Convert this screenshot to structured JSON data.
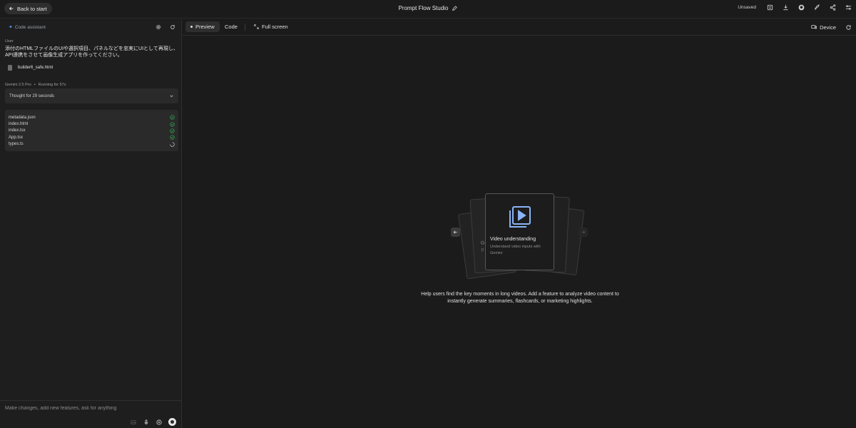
{
  "topbar": {
    "back_label": "Back to start",
    "title": "Prompt Flow Studio",
    "status": "Unsaved",
    "icons": [
      "switch-icon",
      "download-icon",
      "github-icon",
      "rocket-icon",
      "share-icon",
      "settings-sliders-icon"
    ]
  },
  "assistant": {
    "header_label": "Code assistant",
    "user_label": "User",
    "user_message": "添付のHTMLファイルのUIや選択項目、パネルなどを忠実にUIとして再現し、API連携をさせて画像生成アプリを作ってください。",
    "attachment": "builder6_safe.html",
    "model": "Gemini 2.5 Pro",
    "separator": "•",
    "run_status": "Running for 57s",
    "thought": "Thought for 29 seconds",
    "files": [
      {
        "name": "metadata.json",
        "status": "done"
      },
      {
        "name": "index.html",
        "status": "done"
      },
      {
        "name": "index.tsx",
        "status": "done"
      },
      {
        "name": "App.tsx",
        "status": "done"
      },
      {
        "name": "types.ts",
        "status": "loading"
      }
    ],
    "composer_placeholder": "Make changes, add new features, ask for anything"
  },
  "preview": {
    "tabs": [
      "Preview",
      "Code",
      "Full screen"
    ],
    "device_label": "Device",
    "card_title": "Video understanding",
    "card_desc": "Understand video inputs with Gemini",
    "back_card_fragment": "Ge",
    "back_card_fragment2": "p",
    "description": "Help users find the key moments in long videos. Add a feature to analyze video content to instantly generate summaries, flashcards, or marketing highlights."
  },
  "colors": {
    "background": "#1b1b1b",
    "panel": "#1e1e1e",
    "accent_blue": "#8ab4f8",
    "success_green": "#34a853"
  }
}
